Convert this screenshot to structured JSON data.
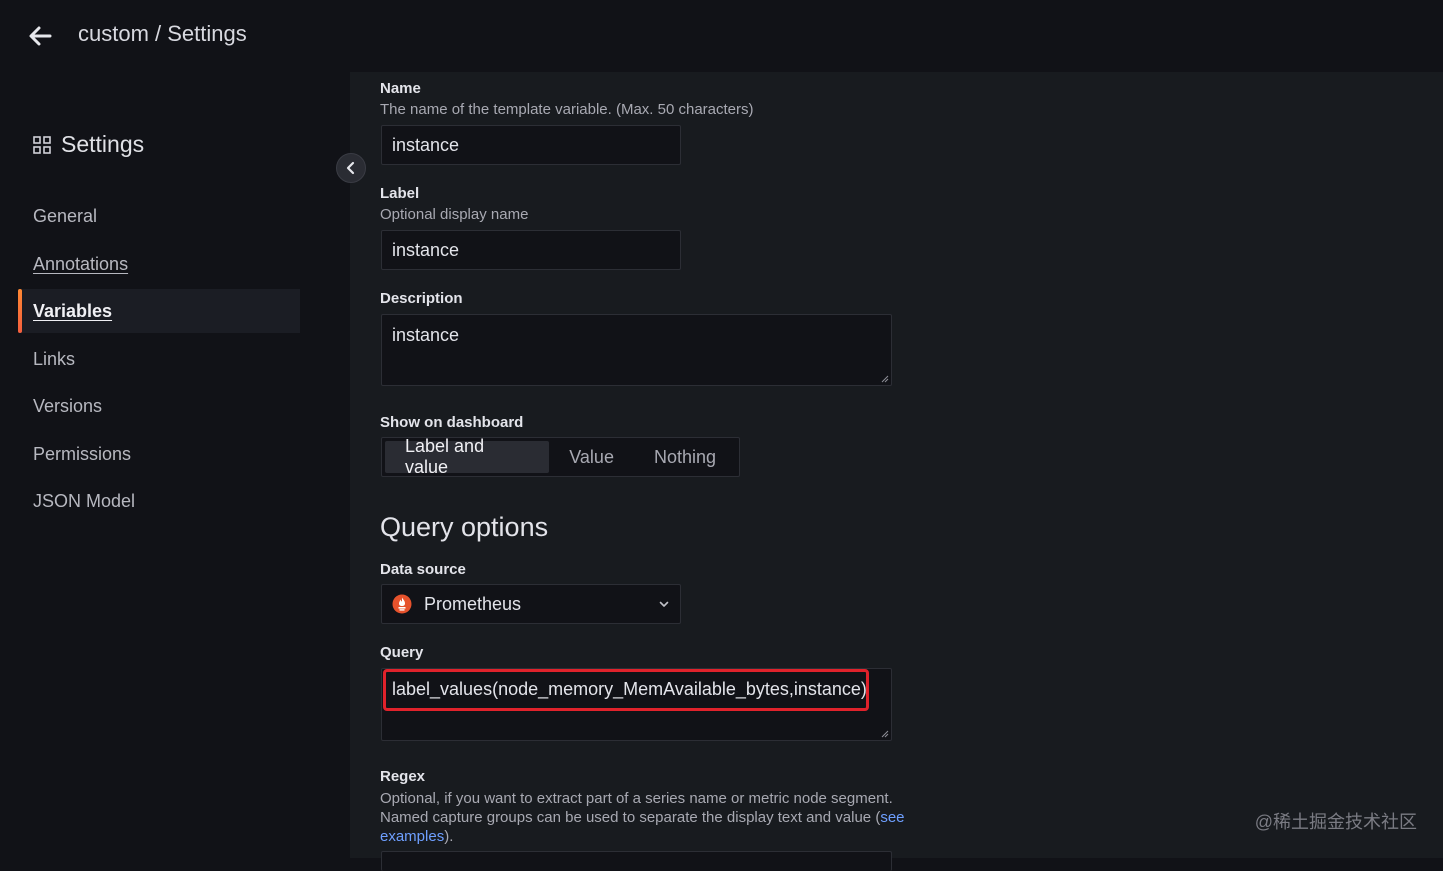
{
  "topbar": {
    "title": "custom / Settings"
  },
  "sidebar": {
    "heading": "Settings",
    "items": [
      {
        "label": "General"
      },
      {
        "label": "Annotations"
      },
      {
        "label": "Variables"
      },
      {
        "label": "Links"
      },
      {
        "label": "Versions"
      },
      {
        "label": "Permissions"
      },
      {
        "label": "JSON Model"
      }
    ]
  },
  "form": {
    "name": {
      "label": "Name",
      "description": "The name of the template variable. (Max. 50 characters)",
      "value": "instance"
    },
    "label": {
      "label": "Label",
      "description": "Optional display name",
      "value": "instance"
    },
    "description": {
      "label": "Description",
      "value": "instance"
    },
    "show_on_dashboard": {
      "label": "Show on dashboard",
      "options": [
        "Label and value",
        "Value",
        "Nothing"
      ],
      "selected": "Label and value"
    },
    "query_options": {
      "title": "Query options",
      "data_source": {
        "label": "Data source",
        "value": "Prometheus"
      },
      "query": {
        "label": "Query",
        "value": "label_values(node_memory_MemAvailable_bytes,instance)"
      },
      "regex": {
        "label": "Regex",
        "description_line1": "Optional, if you want to extract part of a series name or metric node segment.",
        "description_line2": "Named capture groups can be used to separate the display text and value (",
        "link_text_1": "see",
        "link_text_2": "examples",
        "description_end": ")."
      }
    }
  },
  "watermark": "@稀土掘金技术社区",
  "colors": {
    "accent": "#f55f3e",
    "highlight": "#e0222b",
    "link": "#6e9fff",
    "prometheus": "#e6522c"
  }
}
